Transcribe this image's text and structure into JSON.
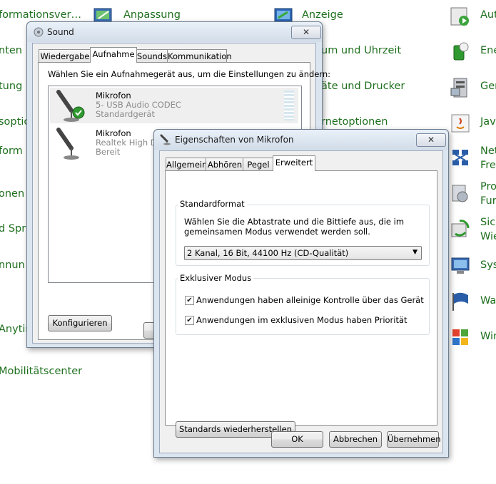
{
  "control_panel": {
    "links": [
      "formationsver…",
      "Anpassung",
      "Anzeige",
      "Aut",
      "nten",
      "um und Uhrzeit",
      "Ene",
      "tung",
      "äte und Drucker",
      "Ger",
      "soptic",
      "rnetoptionen",
      "Jav",
      "form",
      "Net",
      "Fre",
      "onen",
      "Pro",
      "Fur",
      "d Spra",
      "Sich",
      "Wie",
      "nnun",
      "Sys",
      "Wa",
      "Anytim",
      "Win",
      "Mobilitätscenter"
    ]
  },
  "sound_dialog": {
    "title": "Sound",
    "close_label": "✕",
    "tabs": [
      "Wiedergabe",
      "Aufnahme",
      "Sounds",
      "Kommunikation"
    ],
    "active_tab": "Aufnahme",
    "instruction": "Wählen Sie ein Aufnahmegerät aus, um die Einstellungen zu ändern:",
    "devices": [
      {
        "name": "Mikrofon",
        "detail": "5- USB Audio CODEC",
        "status": "Standardgerät"
      },
      {
        "name": "Mikrofon",
        "detail": "Realtek High De",
        "status": "Bereit"
      }
    ],
    "configure_label": "Konfigurieren"
  },
  "mic_props_dialog": {
    "title": "Eigenschaften von Mikrofon",
    "close_label": "✕",
    "tabs": [
      "Allgemein",
      "Abhören",
      "Pegel",
      "Erweitert"
    ],
    "active_tab": "Erweitert",
    "default_format": {
      "label": "Standardformat",
      "description_line1": "Wählen Sie die Abtastrate und die Bittiefe aus, die im",
      "description_line2": "gemeinsamen Modus verwendet werden soll.",
      "selected": "2 Kanal, 16 Bit, 44100 Hz (CD-Qualität)"
    },
    "exclusive_mode": {
      "label": "Exklusiver Modus",
      "option1": "Anwendungen haben alleinige Kontrolle über das Gerät",
      "option1_checked": true,
      "option2": "Anwendungen im exklusiven Modus haben Priorität",
      "option2_checked": true
    },
    "restore_label": "Standards wiederherstellen",
    "ok_label": "OK",
    "cancel_label": "Abbrechen",
    "apply_label": "Übernehmen"
  }
}
